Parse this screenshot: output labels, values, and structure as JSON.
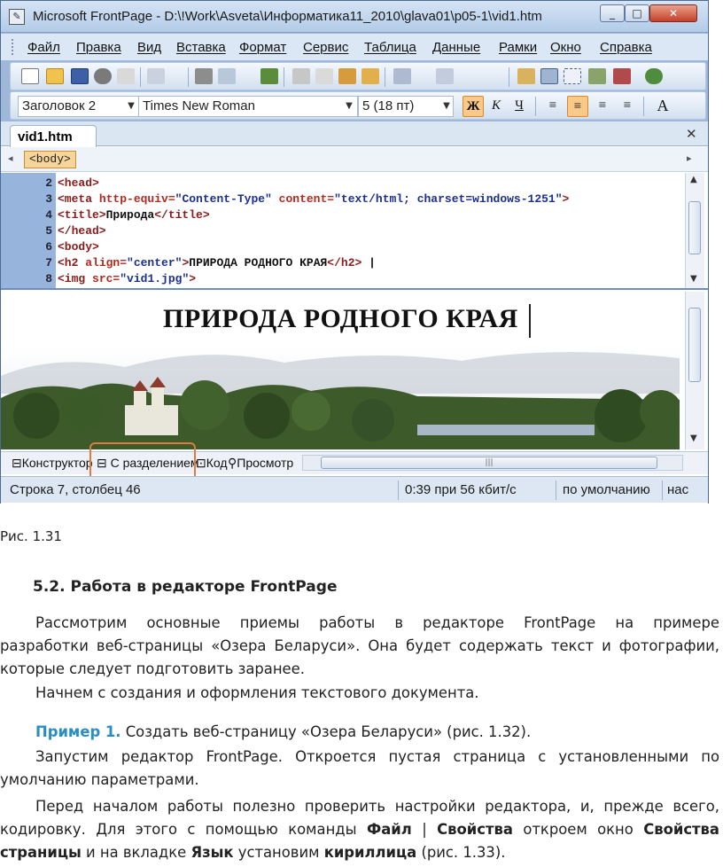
{
  "window": {
    "title": "Microsoft FrontPage - D:\\!Work\\Asveta\\Информатика11_2010\\glava01\\p05-1\\vid1.htm"
  },
  "menu": [
    "Файл",
    "Правка",
    "Вид",
    "Вставка",
    "Формат",
    "Сервис",
    "Таблица",
    "Данные",
    "Рамки",
    "Окно",
    "Справка"
  ],
  "toolbar2": {
    "style": "Заголовок 2",
    "font": "Times New Roman",
    "size": "5  (18 пт)",
    "bold": "Ж",
    "italic": "К",
    "underline": "Ч",
    "font_a": "A"
  },
  "doc": {
    "tab": "vid1.htm",
    "tag": "<body>",
    "code_lines": [
      {
        "n": "2",
        "parts": [
          [
            "tag",
            "<head>"
          ]
        ]
      },
      {
        "n": "3",
        "parts": [
          [
            "tag",
            "<meta "
          ],
          [
            "attr",
            "http-equiv="
          ],
          [
            "val",
            "\"Content-Type\" "
          ],
          [
            "attr",
            "content="
          ],
          [
            "val",
            "\"text/html; charset=windows-1251\""
          ],
          [
            "tag",
            ">"
          ]
        ]
      },
      {
        "n": "4",
        "parts": [
          [
            "tag",
            "<title>"
          ],
          [
            "plain",
            "Природа"
          ],
          [
            "tag",
            "</title>"
          ]
        ]
      },
      {
        "n": "5",
        "parts": [
          [
            "tag",
            "</head>"
          ]
        ]
      },
      {
        "n": "6",
        "parts": [
          [
            "tag",
            "<body>"
          ]
        ]
      },
      {
        "n": "7",
        "parts": [
          [
            "tag",
            "<h2 "
          ],
          [
            "attr",
            "align="
          ],
          [
            "val",
            "\"center\""
          ],
          [
            "tag",
            ">"
          ],
          [
            "plain",
            "ПРИРОДА РОДНОГО КРАЯ"
          ],
          [
            "tag",
            "</h2>"
          ],
          [
            "plain",
            " |"
          ]
        ]
      },
      {
        "n": "8",
        "parts": [
          [
            "tag",
            "<img "
          ],
          [
            "attr",
            "src="
          ],
          [
            "val",
            "\"vid1.jpg\""
          ],
          [
            "tag",
            ">"
          ]
        ]
      }
    ],
    "design_heading": "ПРИРОДА РОДНОГО КРАЯ"
  },
  "views": {
    "design": "Конструктор",
    "split": "С разделением",
    "code": "Код",
    "preview": "Просмотр"
  },
  "status": {
    "position": "Строка 7, столбец 46",
    "speed": "0:39 при 56 кбит/с",
    "mode": "по умолчанию",
    "extra": "нас"
  },
  "text": {
    "caption": "Рис. 1.31",
    "section_title": "5.2. Работа в редакторе FrontPage",
    "p1_line1": "Рассмотрим основные приемы работы в редакторе FrontPage на примере",
    "p1_line2": "разработки веб-страницы «Озера Беларуси». Она будет содержать текст и фотографии,",
    "p1_line3": "которые следует подготовить заранее.",
    "p2": "Начнем с создания и оформления текстового документа.",
    "example_label": "Пример 1.",
    "example_text": " Создать веб-страницу «Озера Беларуси» (рис. 1.32).",
    "p3_line1": "Запустим редактор FrontPage. Откроется пустая страница с установленными по",
    "p3_line2": "умолчанию параметрами.",
    "p4_line1": "Перед началом работы полезно проверить настройки редактора, и, прежде всего,",
    "p4_l2_a": "кодировку. Для этого с помощью команды ",
    "p4_l2_b": "Файл",
    "p4_l2_c": " | ",
    "p4_l2_d": "Свойства",
    "p4_l2_e": " откроем окно ",
    "p4_l2_f": "Свойства",
    "p4_l3_a": "страницы",
    "p4_l3_b": " и на вкладке ",
    "p4_l3_c": "Язык",
    "p4_l3_d": " установим ",
    "p4_l3_e": "кириллица",
    "p4_l3_f": " (рис. 1.33)."
  }
}
